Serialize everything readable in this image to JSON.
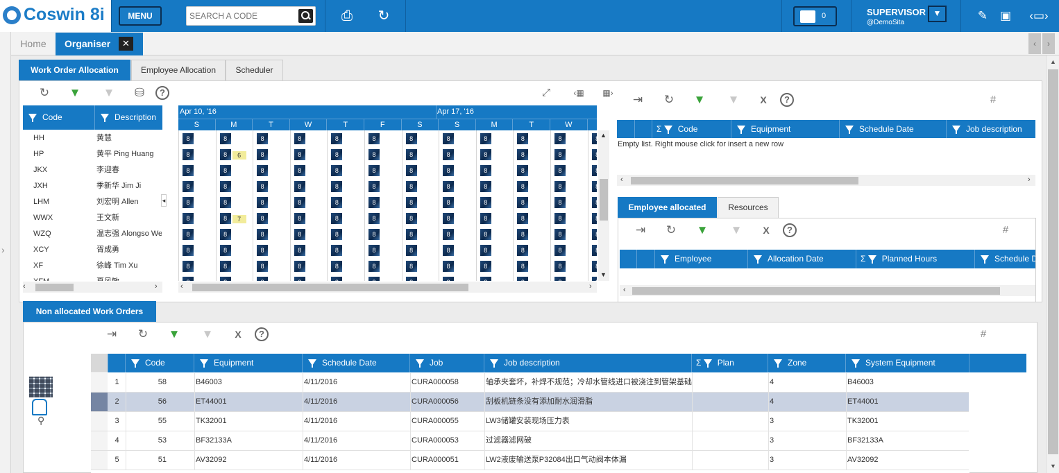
{
  "app": {
    "logo_text": "Coswin 8i",
    "menu_label": "MENU",
    "search_placeholder": "SEARCH A CODE",
    "notification_count": "0",
    "user_name": "SUPERVISOR",
    "user_site": "@DemoSita"
  },
  "tabs": {
    "home": "Home",
    "organiser": "Organiser",
    "close": "✕"
  },
  "subtabs": [
    "Work Order Allocation",
    "Employee Allocation",
    "Scheduler"
  ],
  "employees": {
    "headers": {
      "code": "Code",
      "description": "Description"
    },
    "rows": [
      {
        "code": "HH",
        "desc": "黄慧"
      },
      {
        "code": "HP",
        "desc": "黄平 Ping Huang"
      },
      {
        "code": "JKX",
        "desc": "李迎春"
      },
      {
        "code": "JXH",
        "desc": "季新华 Jim Ji"
      },
      {
        "code": "LHM",
        "desc": "刘宏明 Allen"
      },
      {
        "code": "WWX",
        "desc": "王文新"
      },
      {
        "code": "WZQ",
        "desc": "温志强 Alongso Wei"
      },
      {
        "code": "XCY",
        "desc": "胥成勇"
      },
      {
        "code": "XF",
        "desc": "徐峰 Tim Xu"
      },
      {
        "code": "XFM",
        "desc": "夏风敏"
      }
    ]
  },
  "calendar": {
    "weeks": [
      "Apr 10, '16",
      "Apr 17, '16"
    ],
    "days": [
      "S",
      "M",
      "T",
      "W",
      "T",
      "F",
      "S",
      "S",
      "M",
      "T",
      "W",
      "T"
    ],
    "hours_value": "8",
    "highlights": [
      {
        "row": 1,
        "value": "6"
      },
      {
        "row": 5,
        "value": "7"
      }
    ]
  },
  "wo_top": {
    "headers": [
      "Code",
      "Equipment",
      "Schedule Date",
      "Job description"
    ],
    "empty_text": "Empty list. Right mouse click for insert a new row"
  },
  "alloc_tabs": [
    "Employee allocated",
    "Resources"
  ],
  "alloc_table": {
    "headers": [
      "Employee",
      "Allocation Date",
      "Planned Hours",
      "Schedule Date"
    ]
  },
  "non_allocated": {
    "title": "Non allocated Work Orders",
    "headers": [
      "Code",
      "Equipment",
      "Schedule Date",
      "Job",
      "Job description",
      "Plan",
      "Zone",
      "System Equipment"
    ],
    "rows": [
      {
        "n": "1",
        "code": "58",
        "equip": "B46003",
        "date": "4/11/2016",
        "job": "CURA000058",
        "desc": "轴承夹套坏，补焊不规范；冷却水管线进口被浇注到管架基础",
        "plan": "",
        "zone": "4",
        "sys": "B46003"
      },
      {
        "n": "2",
        "code": "56",
        "equip": "ET44001",
        "date": "4/11/2016",
        "job": "CURA000056",
        "desc": "刮板机链条没有添加耐水润滑脂",
        "plan": "",
        "zone": "4",
        "sys": "ET44001"
      },
      {
        "n": "3",
        "code": "55",
        "equip": "TK32001",
        "date": "4/11/2016",
        "job": "CURA000055",
        "desc": "LW3储罐安装现场压力表",
        "plan": "",
        "zone": "3",
        "sys": "TK32001"
      },
      {
        "n": "4",
        "code": "53",
        "equip": "BF32133A",
        "date": "4/11/2016",
        "job": "CURA000053",
        "desc": "过滤器滤网破",
        "plan": "",
        "zone": "3",
        "sys": "BF32133A"
      },
      {
        "n": "5",
        "code": "51",
        "equip": "AV32092",
        "date": "4/11/2016",
        "job": "CURA000051",
        "desc": "LW2液废输送泵P32084出口气动阀本体漏",
        "plan": "",
        "zone": "3",
        "sys": "AV32092"
      }
    ]
  },
  "icons": {
    "sigma": "Σ",
    "hash": "#",
    "help": "?"
  },
  "colors": {
    "brand": "#1679c4",
    "selected_row": "#c9d2e2",
    "highlight": "#f2ec9b"
  }
}
